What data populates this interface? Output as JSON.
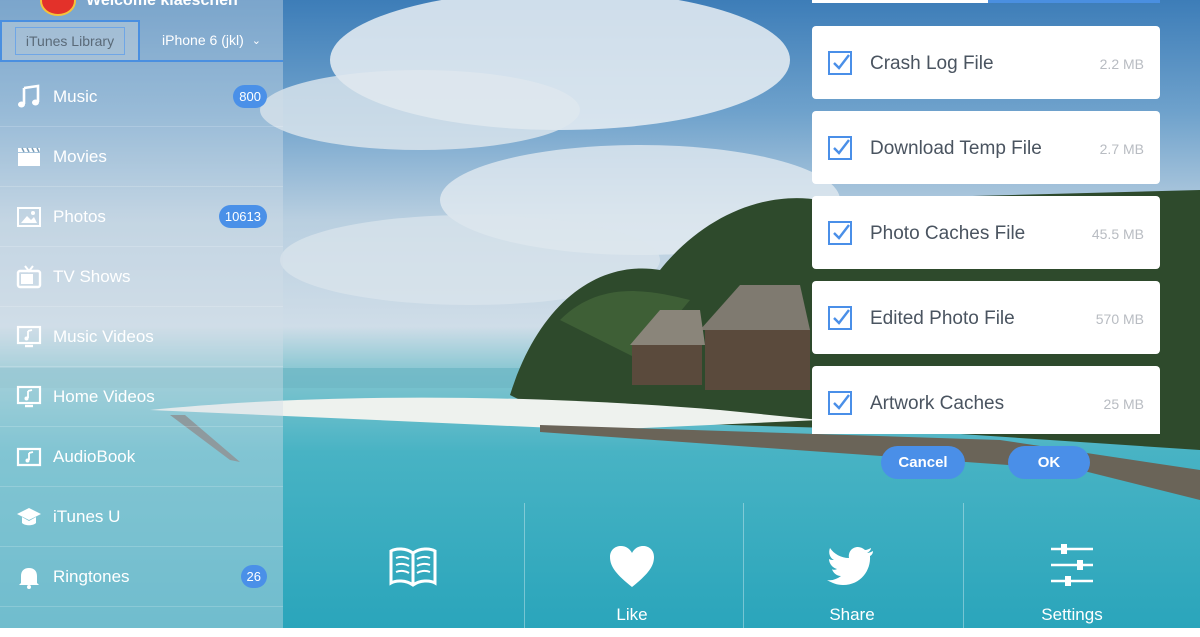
{
  "header": {
    "welcome": "Welcome klaeschen"
  },
  "tabs": {
    "library": "iTunes Library",
    "device": "iPhone 6 (jkl)"
  },
  "sidebar": {
    "items": [
      {
        "label": "Music",
        "icon": "music-note-icon",
        "badge": "800"
      },
      {
        "label": "Movies",
        "icon": "film-clapper-icon",
        "badge": ""
      },
      {
        "label": "Photos",
        "icon": "photo-icon",
        "badge": "10613"
      },
      {
        "label": "TV Shows",
        "icon": "tv-icon",
        "badge": ""
      },
      {
        "label": "Music Videos",
        "icon": "music-video-icon",
        "badge": ""
      },
      {
        "label": "Home Videos",
        "icon": "home-video-icon",
        "badge": ""
      },
      {
        "label": "AudioBook",
        "icon": "audiobook-icon",
        "badge": ""
      },
      {
        "label": "iTunes U",
        "icon": "graduation-cap-icon",
        "badge": ""
      },
      {
        "label": "Ringtones",
        "icon": "bell-icon",
        "badge": "26"
      }
    ]
  },
  "files": [
    {
      "name": "Crash Log File",
      "size": "2.2 MB",
      "checked": true
    },
    {
      "name": "Download Temp File",
      "size": "2.7 MB",
      "checked": true
    },
    {
      "name": "Photo Caches File",
      "size": "45.5 MB",
      "checked": true
    },
    {
      "name": "Edited Photo File",
      "size": "570 MB",
      "checked": true
    },
    {
      "name": "Artwork Caches",
      "size": "25 MB",
      "checked": true
    }
  ],
  "dialog": {
    "cancel": "Cancel",
    "ok": "OK"
  },
  "bottom_bar": {
    "items": [
      {
        "label": "",
        "icon": "book-icon"
      },
      {
        "label": "Like",
        "icon": "heart-icon"
      },
      {
        "label": "Share",
        "icon": "twitter-bird-icon"
      },
      {
        "label": "Settings",
        "icon": "sliders-icon"
      }
    ]
  },
  "colors": {
    "accent": "#4a8fe8",
    "badge": "#4a90e8",
    "text_dark": "#4a5460",
    "size_text": "#b8bcc2"
  }
}
